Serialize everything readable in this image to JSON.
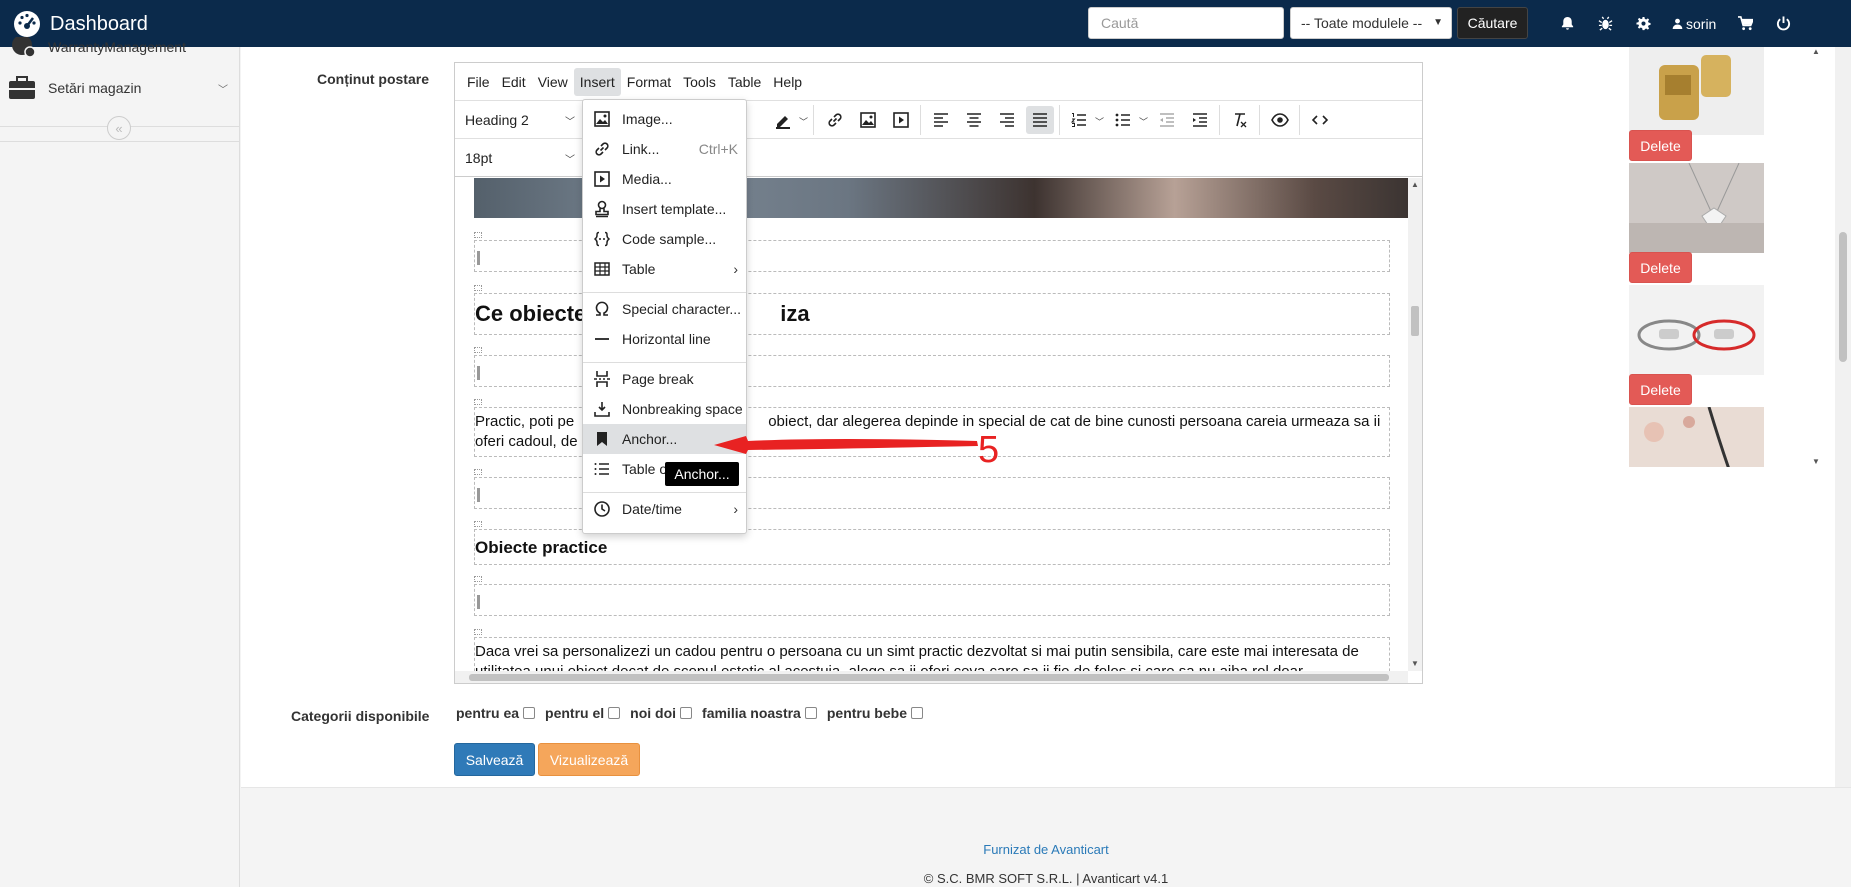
{
  "header": {
    "brand": "Dashboard",
    "search_placeholder": "Caută",
    "module_select": "-- Toate modulele --",
    "search_button": "Căutare",
    "user": "sorin"
  },
  "sidebar": {
    "items": [
      {
        "label": "WarrantyManagement"
      },
      {
        "label": "Setări magazin"
      }
    ]
  },
  "form": {
    "content_label": "Conținut postare",
    "categories_label": "Categorii disponibile",
    "categories": [
      "pentru ea",
      "pentru el",
      "noi doi",
      "familia noastra",
      "pentru bebe"
    ],
    "save_button": "Salvează",
    "preview_button": "Vizualizează"
  },
  "editor": {
    "menus": [
      "File",
      "Edit",
      "View",
      "Insert",
      "Format",
      "Tools",
      "Table",
      "Help"
    ],
    "active_menu": "Insert",
    "block_format": "Heading 2",
    "font_size": "18pt",
    "heading_partial_left": "Ce obiecte",
    "heading_partial_right": "iza",
    "paragraph1_line1_left": "Practic, poti pe",
    "paragraph1_line1_right": "obiect, dar alegerea depinde in special de cat de bine cunosti persoana careia urmeaza sa ii",
    "paragraph1_line2_left": "oferi cadoul, de",
    "heading3": "Obiecte practice",
    "paragraph2_line1": "Daca vrei sa personalizezi un cadou pentru o persoana cu un simt practic dezvoltat si mai putin sensibila, care este mai interesata de",
    "paragraph2_line2": "utilitatea unui obiect decat de scopul estetic al acestuia, alege sa ii oferi ceva care sa ii fie de folos si care sa nu aiba rol doar"
  },
  "insert_menu": {
    "items": [
      {
        "label": "Image...",
        "icon": "image-icon"
      },
      {
        "label": "Link...",
        "icon": "link-icon",
        "shortcut": "Ctrl+K"
      },
      {
        "label": "Media...",
        "icon": "media-icon"
      },
      {
        "label": "Insert template...",
        "icon": "template-icon"
      },
      {
        "label": "Code sample...",
        "icon": "code-sample-icon"
      },
      {
        "label": "Table",
        "icon": "table-icon"
      },
      {
        "label": "Special character...",
        "icon": "omega-icon"
      },
      {
        "label": "Horizontal line",
        "icon": "horizontal-line-icon"
      },
      {
        "label": "Page break",
        "icon": "page-break-icon"
      },
      {
        "label": "Nonbreaking space",
        "icon": "nbsp-icon"
      },
      {
        "label": "Anchor...",
        "icon": "bookmark-icon"
      },
      {
        "label": "Table o",
        "icon": "toc-icon"
      },
      {
        "label": "Date/time",
        "icon": "clock-icon"
      }
    ],
    "highlighted": "Anchor...",
    "tooltip": "Anchor..."
  },
  "annotation": {
    "step_number": "5",
    "color": "#e82222"
  },
  "gallery": {
    "delete_label": "Delete"
  },
  "footer": {
    "link": "Furnizat de Avanticart",
    "copyright": "© S.C. BMR SOFT S.R.L. | Avanticart v4.1"
  },
  "colors": {
    "topbar": "#0b2a4b",
    "primary": "#2f7ab8",
    "warning": "#f5a65b",
    "danger": "#e35a56"
  }
}
